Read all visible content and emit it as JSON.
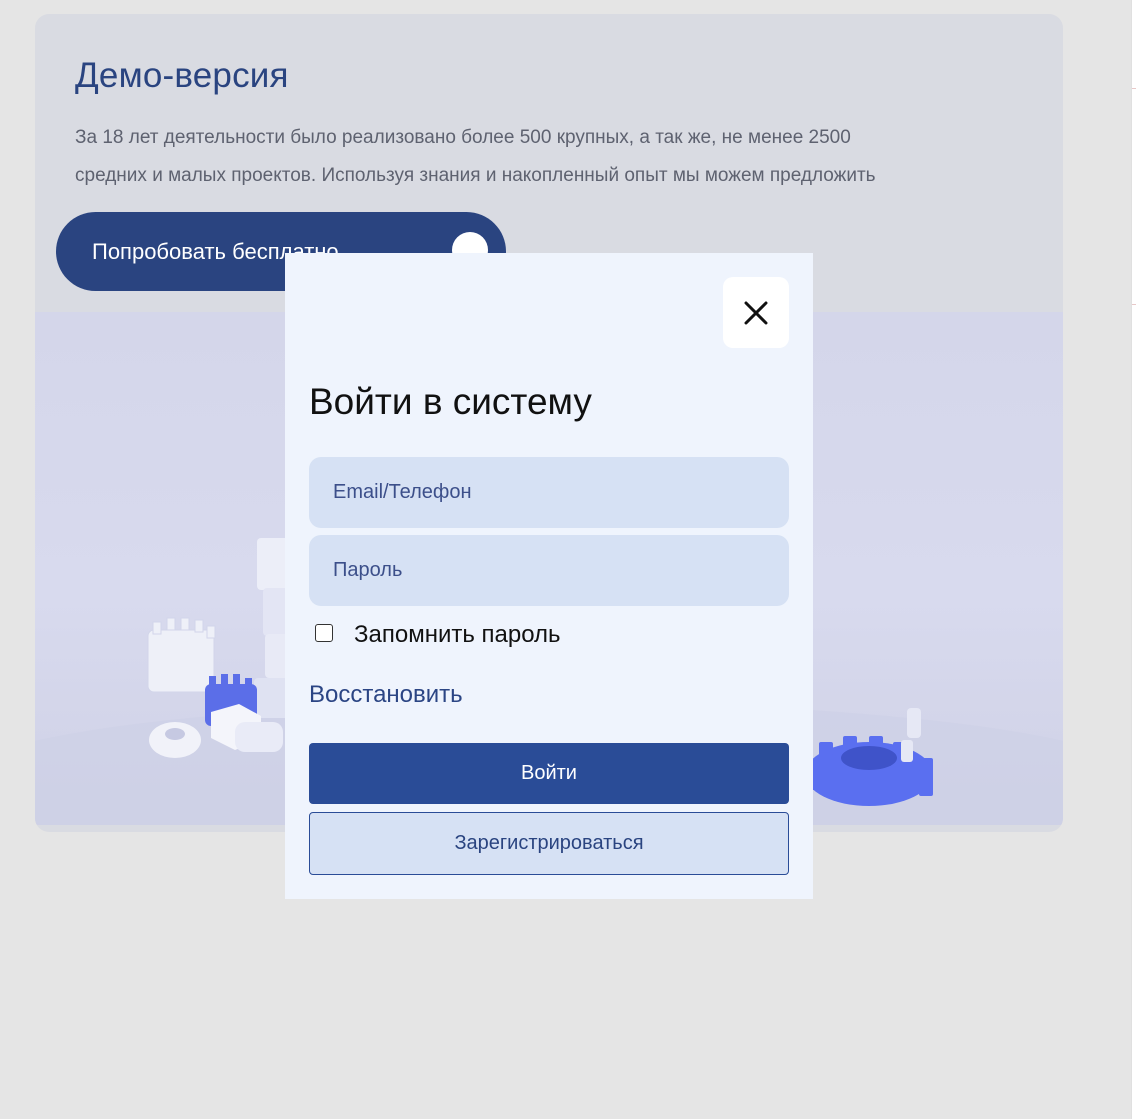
{
  "demo": {
    "title": "Демо-версия",
    "description": "За 18 лет деятельности было реализовано более 500 крупных, а так же, не менее 2500 средних и малых проектов. Используя знания и накопленный опыт мы можем предложить",
    "try_button_label": "Попробовать бесплатно",
    "try_button_icon": "arrow-up-right-icon",
    "image_icon": "gears-illustration"
  },
  "login_modal": {
    "close_icon": "close-icon",
    "title": "Войти в систему",
    "email_placeholder": "Email/Телефон",
    "password_placeholder": "Пароль",
    "remember_label": "Запомнить пароль",
    "remember_checked": false,
    "restore_link": "Восстановить",
    "login_button": "Войти",
    "register_button": "Зарегистрироваться"
  },
  "colors": {
    "brand": "#2a4480",
    "button": "#2a4c97",
    "field_bg": "#d6e1f4",
    "modal_bg": "#eff4fd",
    "page_bg": "#e5e5e5"
  }
}
